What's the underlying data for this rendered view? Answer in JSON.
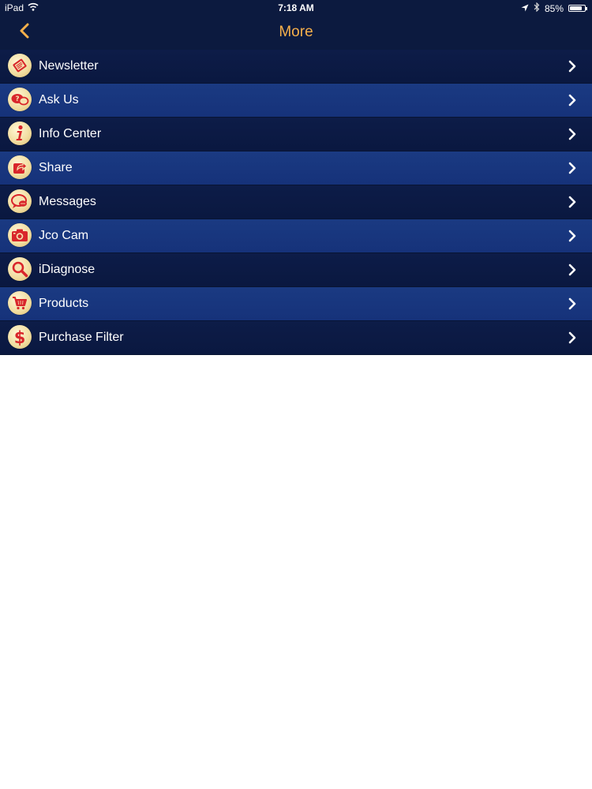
{
  "status_bar": {
    "device": "iPad",
    "time": "7:18 AM",
    "battery": "85%",
    "battery_level": 0.85,
    "icons": [
      "wifi-icon",
      "location-arrow-icon",
      "bluetooth-icon",
      "battery-icon"
    ]
  },
  "nav": {
    "title": "More",
    "back_icon": "chevron-left-icon"
  },
  "colors": {
    "bar_background": "#0c1a3f",
    "title_accent": "#f6b04b",
    "row_dark": "#0d1c48",
    "row_light": "#1a3a82",
    "icon_red": "#d9262b",
    "icon_cream": "#f1dc9e"
  },
  "menu": {
    "items": [
      {
        "label": "Newsletter",
        "icon": "newsletter-icon"
      },
      {
        "label": "Ask Us",
        "icon": "chat-bubbles-icon"
      },
      {
        "label": "Info Center",
        "icon": "info-icon"
      },
      {
        "label": "Share",
        "icon": "share-icon"
      },
      {
        "label": "Messages",
        "icon": "message-icon"
      },
      {
        "label": "Jco Cam",
        "icon": "camera-icon"
      },
      {
        "label": "iDiagnose",
        "icon": "magnifier-icon"
      },
      {
        "label": "Products",
        "icon": "cart-icon"
      },
      {
        "label": "Purchase Filter",
        "icon": "dollar-icon"
      }
    ]
  }
}
